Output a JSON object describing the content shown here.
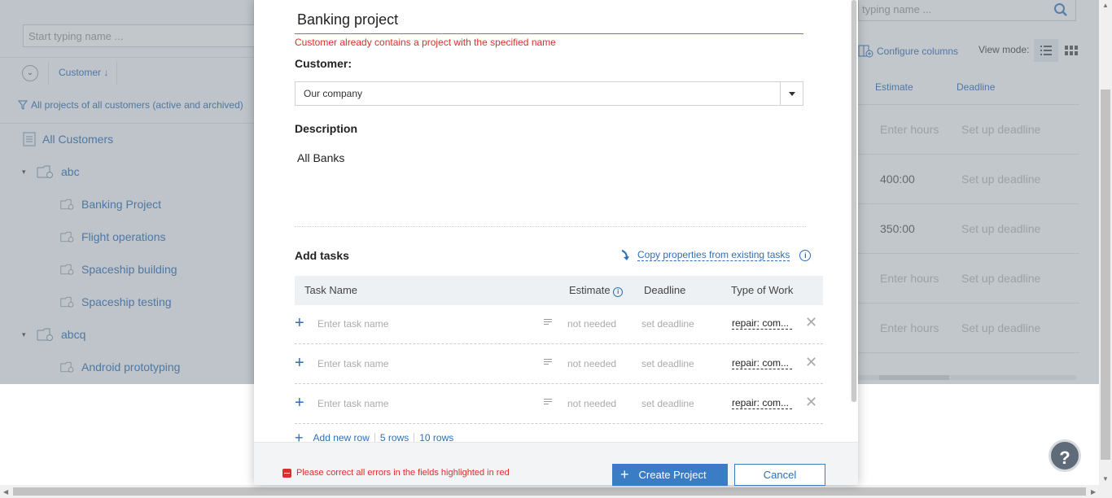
{
  "background": {
    "left_panel": {
      "search_placeholder": "Start typing name ...",
      "customer_sort_label": "Customer ↓",
      "filter_text": "All projects of all customers (active and archived)",
      "tree": [
        {
          "label": "All Customers",
          "level": 0,
          "icon": "list-icon"
        },
        {
          "label": "abc",
          "level": 0,
          "icon": "folder-icon",
          "expanded": true
        },
        {
          "label": "Banking Project",
          "level": 1,
          "icon": "folder-icon"
        },
        {
          "label": "Flight operations",
          "level": 1,
          "icon": "folder-icon"
        },
        {
          "label": "Spaceship building",
          "level": 1,
          "icon": "folder-icon"
        },
        {
          "label": "Spaceship testing",
          "level": 1,
          "icon": "folder-icon"
        },
        {
          "label": "abcq",
          "level": 0,
          "icon": "folder-icon",
          "expanded": true
        },
        {
          "label": "Android prototyping",
          "level": 1,
          "icon": "folder-icon"
        }
      ]
    },
    "right_panel": {
      "search_placeholder": "typing name ...",
      "configure_columns": "Configure columns",
      "view_mode_label": "View mode:",
      "columns": [
        "Estimate",
        "Deadline"
      ],
      "rows": [
        {
          "estimate": "Enter hours",
          "deadline": "Set up deadline"
        },
        {
          "estimate": "400:00",
          "deadline": "Set up deadline"
        },
        {
          "estimate": "350:00",
          "deadline": "Set up deadline"
        },
        {
          "estimate": "Enter hours",
          "deadline": "Set up deadline"
        },
        {
          "estimate": "Enter hours",
          "deadline": "Set up deadline"
        }
      ]
    },
    "help_label": "?"
  },
  "modal": {
    "project_name": "Banking project",
    "name_error": "Customer already contains a project with the specified name",
    "customer_label": "Customer:",
    "customer_value": "Our company",
    "description_label": "Description",
    "description_value": "All Banks",
    "add_tasks_label": "Add tasks",
    "copy_properties_label": "Copy properties from existing tasks",
    "task_columns": {
      "name": "Task Name",
      "estimate": "Estimate",
      "deadline": "Deadline",
      "type": "Type of Work"
    },
    "task_rows": [
      {
        "name_placeholder": "Enter task name",
        "estimate": "not needed",
        "deadline": "set deadline",
        "type": "repair: com..."
      },
      {
        "name_placeholder": "Enter task name",
        "estimate": "not needed",
        "deadline": "set deadline",
        "type": "repair: com..."
      },
      {
        "name_placeholder": "Enter task name",
        "estimate": "not needed",
        "deadline": "set deadline",
        "type": "repair: com..."
      }
    ],
    "add_new_row": "Add new row",
    "five_rows": "5 rows",
    "ten_rows": "10 rows",
    "footer_error": "Please correct all errors in the fields highlighted in red",
    "create_button": "Create Project",
    "cancel_button": "Cancel"
  },
  "colors": {
    "accent": "#3b7dc4",
    "link": "#2e6fb7",
    "error": "#d9302b"
  }
}
